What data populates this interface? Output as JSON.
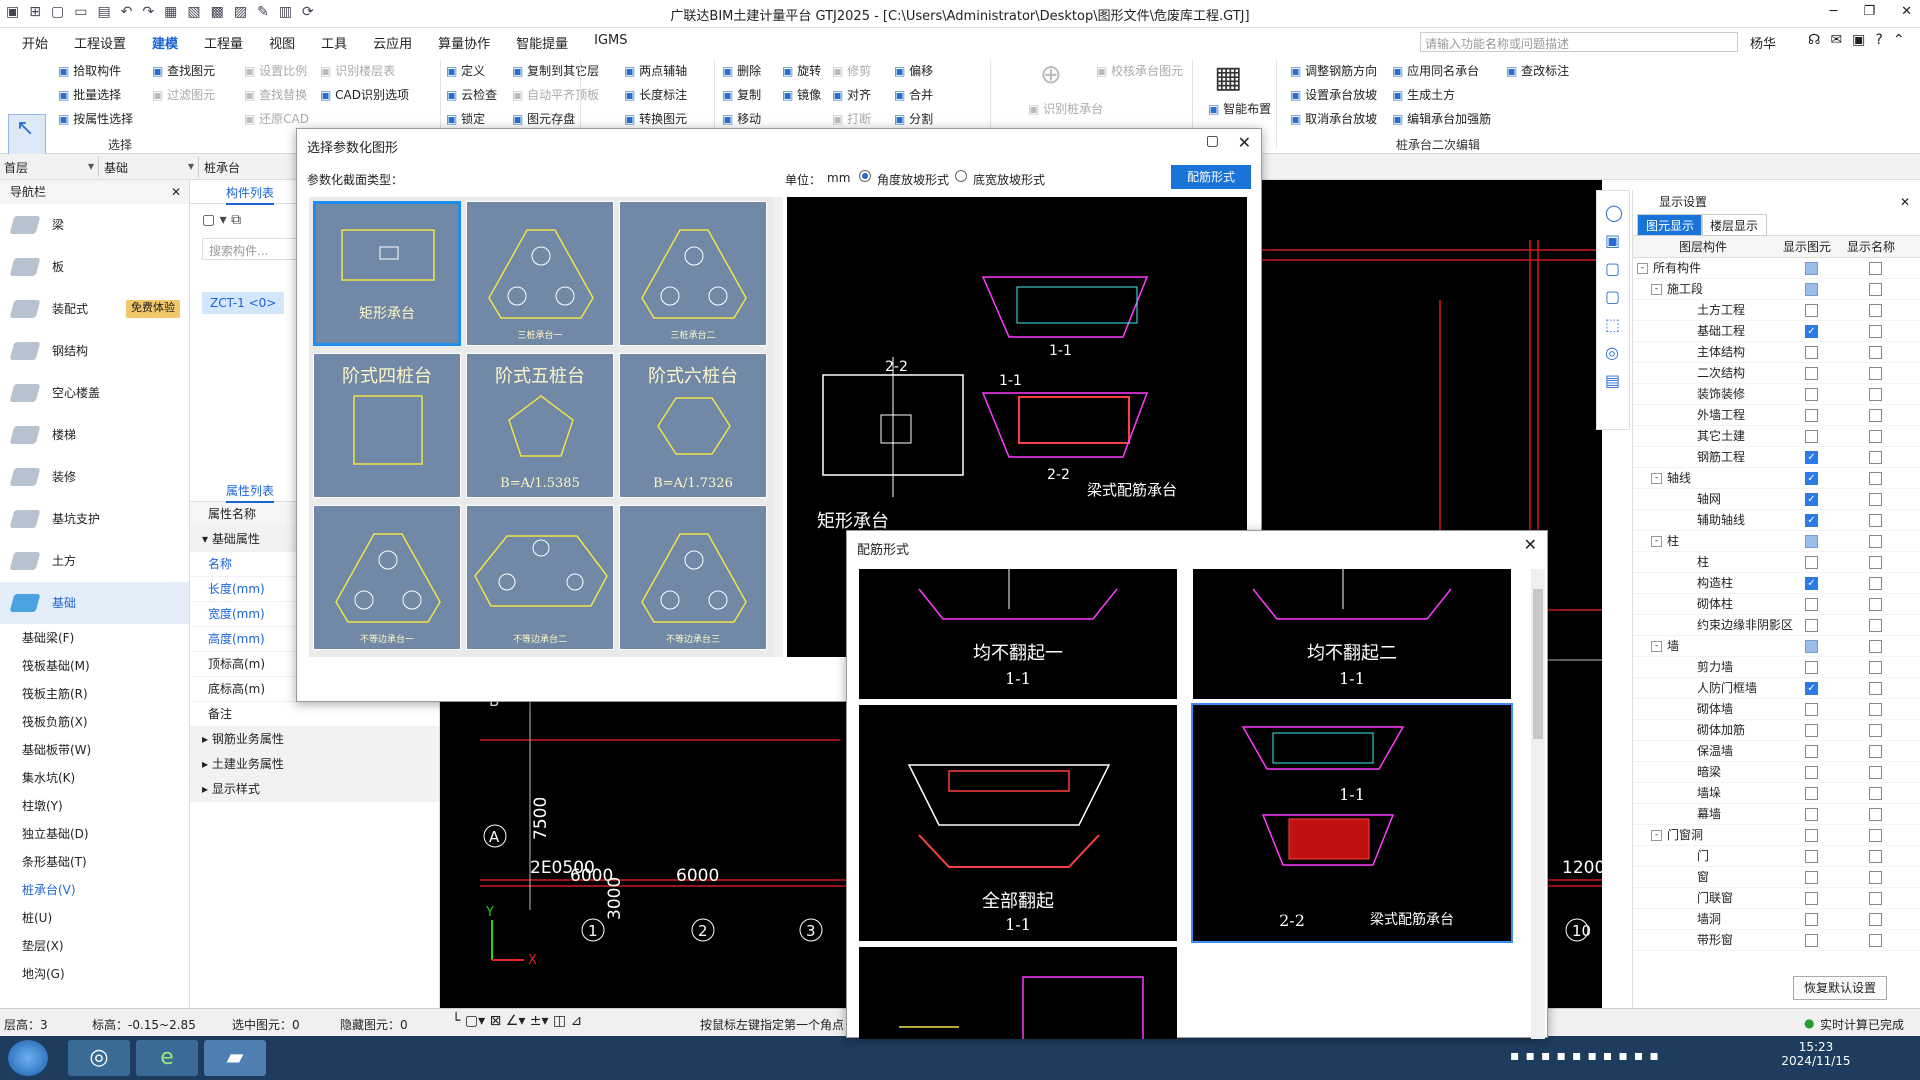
{
  "app": {
    "title": "广联达BIM土建计量平台 GTJ2025 - [C:\\Users\\Administrator\\Desktop\\图形文件\\危废库工程.GTJ]",
    "menus": [
      "开始",
      "工程设置",
      "建模",
      "工程量",
      "视图",
      "工具",
      "云应用",
      "算量协作",
      "智能提量",
      "IGMS"
    ],
    "active_menu": "建模",
    "search_placeholder": "请输入功能名称或问题描述",
    "user": "杨华"
  },
  "ribbon": {
    "select": "选择",
    "col1": [
      "拾取构件",
      "批量选择",
      "按属性选择"
    ],
    "col2": [
      "查找图元",
      "过滤图元"
    ],
    "col3": [
      "设置比例",
      "查找替换",
      "还原CAD"
    ],
    "col4": [
      "识别楼层表",
      "CAD识别选项"
    ],
    "col5": [
      "定义",
      "云检查",
      "锁定"
    ],
    "col6": [
      "复制到其它层",
      "自动平齐顶板",
      "图元存盘"
    ],
    "col7": [
      "两点辅轴",
      "长度标注",
      "转换图元"
    ],
    "col8": [
      "删除",
      "复制",
      "移动"
    ],
    "col9": [
      "旋转",
      "镜像"
    ],
    "col10": [
      "修剪",
      "对齐",
      "打断"
    ],
    "col11": [
      "偏移",
      "合并",
      "分割"
    ],
    "col12": [
      "识别桩承台"
    ],
    "col13": [
      "校核承台图元"
    ],
    "col14": [
      "智能布置"
    ],
    "col15": [
      "调整钢筋方向",
      "设置承台放坡",
      "取消承台放坡"
    ],
    "col16": [
      "应用同名承台",
      "生成土方",
      "编辑承台加强筋"
    ],
    "col17": [
      "查改标注"
    ],
    "group_select": "选择",
    "group_pile": "桩承台二次编辑"
  },
  "levels": {
    "floor": "首层",
    "type": "基础",
    "comp": "桩承台"
  },
  "nav": {
    "title": "导航栏",
    "items": [
      "梁",
      "板",
      "装配式",
      "钢结构",
      "空心楼盖",
      "楼梯",
      "装修",
      "基坑支护",
      "土方",
      "基础"
    ],
    "badge": "免费体验",
    "subitems": [
      "基础梁(F)",
      "筏板基础(M)",
      "筏板主筋(R)",
      "筏板负筋(X)",
      "基础板带(W)",
      "集水坑(K)",
      "柱墩(Y)",
      "独立基础(D)",
      "条形基础(T)",
      "桩承台(V)",
      "桩(U)",
      "垫层(X)",
      "地沟(G)"
    ]
  },
  "complist": {
    "tab": "构件列表",
    "search": "搜索构件...",
    "item": "ZCT-1 <0>"
  },
  "props": {
    "tab": "属性列表",
    "header": "属性名称",
    "group": "基础属性",
    "rows": [
      "名称",
      "长度(mm)",
      "宽度(mm)",
      "高度(mm)",
      "顶标高(m)",
      "底标高(m)",
      "备注"
    ],
    "groups2": [
      "钢筋业务属性",
      "土建业务属性",
      "显示样式"
    ]
  },
  "canvas": {
    "dims": [
      "7500",
      "3000",
      "6000",
      "6000",
      "2E0500",
      "1200"
    ],
    "axes_nums": [
      "1",
      "2",
      "3",
      "10"
    ],
    "axis_A": "A",
    "axis_B": "B",
    "coord_y": "Y",
    "coord_x": "X"
  },
  "display": {
    "title": "显示设置",
    "tabs": [
      "图元显示",
      "楼层显示"
    ],
    "cols": [
      "图层构件",
      "显示图元",
      "显示名称"
    ],
    "rows": [
      {
        "name": "所有构件",
        "lvl": 0,
        "tg": "-",
        "a": "part",
        "b": "off"
      },
      {
        "name": "施工段",
        "lvl": 1,
        "tg": "-",
        "a": "part",
        "b": "off"
      },
      {
        "name": "土方工程",
        "lvl": 2,
        "a": "off",
        "b": "off"
      },
      {
        "name": "基础工程",
        "lvl": 2,
        "a": "on",
        "b": "off"
      },
      {
        "name": "主体结构",
        "lvl": 2,
        "a": "off",
        "b": "off"
      },
      {
        "name": "二次结构",
        "lvl": 2,
        "a": "off",
        "b": "off"
      },
      {
        "name": "装饰装修",
        "lvl": 2,
        "a": "off",
        "b": "off"
      },
      {
        "name": "外墙工程",
        "lvl": 2,
        "a": "off",
        "b": "off"
      },
      {
        "name": "其它土建",
        "lvl": 2,
        "a": "off",
        "b": "off"
      },
      {
        "name": "钢筋工程",
        "lvl": 2,
        "a": "on",
        "b": "off"
      },
      {
        "name": "轴线",
        "lvl": 1,
        "tg": "-",
        "a": "on",
        "b": "off"
      },
      {
        "name": "轴网",
        "lvl": 2,
        "a": "on",
        "b": "off"
      },
      {
        "name": "辅助轴线",
        "lvl": 2,
        "a": "on",
        "b": "off"
      },
      {
        "name": "柱",
        "lvl": 1,
        "tg": "-",
        "a": "part",
        "b": "off"
      },
      {
        "name": "柱",
        "lvl": 2,
        "a": "off",
        "b": "off"
      },
      {
        "name": "构造柱",
        "lvl": 2,
        "a": "on",
        "b": "off"
      },
      {
        "name": "砌体柱",
        "lvl": 2,
        "a": "off",
        "b": "off"
      },
      {
        "name": "约束边缘非阴影区",
        "lvl": 2,
        "a": "off",
        "b": "off"
      },
      {
        "name": "墙",
        "lvl": 1,
        "tg": "-",
        "a": "part",
        "b": "off"
      },
      {
        "name": "剪力墙",
        "lvl": 2,
        "a": "off",
        "b": "off"
      },
      {
        "name": "人防门框墙",
        "lvl": 2,
        "a": "on",
        "b": "off"
      },
      {
        "name": "砌体墙",
        "lvl": 2,
        "a": "off",
        "b": "off"
      },
      {
        "name": "砌体加筋",
        "lvl": 2,
        "a": "off",
        "b": "off"
      },
      {
        "name": "保温墙",
        "lvl": 2,
        "a": "off",
        "b": "off"
      },
      {
        "name": "暗梁",
        "lvl": 2,
        "a": "off",
        "b": "off"
      },
      {
        "name": "墙垛",
        "lvl": 2,
        "a": "off",
        "b": "off"
      },
      {
        "name": "幕墙",
        "lvl": 2,
        "a": "off",
        "b": "off"
      },
      {
        "name": "门窗洞",
        "lvl": 1,
        "tg": "-",
        "a": "off",
        "b": "off"
      },
      {
        "name": "门",
        "lvl": 2,
        "a": "off",
        "b": "off"
      },
      {
        "name": "窗",
        "lvl": 2,
        "a": "off",
        "b": "off"
      },
      {
        "name": "门联窗",
        "lvl": 2,
        "a": "off",
        "b": "off"
      },
      {
        "name": "墙洞",
        "lvl": 2,
        "a": "off",
        "b": "off"
      },
      {
        "name": "带形窗",
        "lvl": 2,
        "a": "off",
        "b": "off"
      }
    ],
    "restore": "恢复默认设置"
  },
  "dialog1": {
    "title": "选择参数化图形",
    "label": "参数化截面类型：",
    "unit_label": "单位：",
    "unit": "mm",
    "radio1": "角度放坡形式",
    "radio2": "底宽放坡形式",
    "rebar_btn": "配筋形式",
    "shapes": [
      "矩形承台",
      "三桩承台一",
      "三桩承台二",
      "阶式四桩台",
      "阶式五桩台",
      "阶式六桩台",
      "不等边承台一",
      "不等边承台二",
      "不等边承台三"
    ],
    "shape_sub": [
      "",
      "",
      "",
      "",
      "B=A/1.5385",
      "B=A/1.7326",
      "",
      "",
      ""
    ],
    "preview_caption": "矩形承台",
    "preview_caption2": "梁式配筋承台",
    "sec11": "1-1",
    "sec22": "2-2"
  },
  "dialog2": {
    "title": "配筋形式",
    "options": [
      "均不翻起一",
      "均不翻起二",
      "全部翻起",
      "梁式配筋承台"
    ],
    "sec11": "1-1",
    "sec22": "2-2"
  },
  "status": {
    "floor_h": "层高：3",
    "elev": "标高：-0.15~2.85",
    "selected": "选中图元：0",
    "hidden": "隐藏图元：0",
    "hint": "按鼠标左键指定第一个角点",
    "calc": "实时计算已完成"
  },
  "taskbar": {
    "time": "15:23",
    "date": "2024/11/15"
  }
}
